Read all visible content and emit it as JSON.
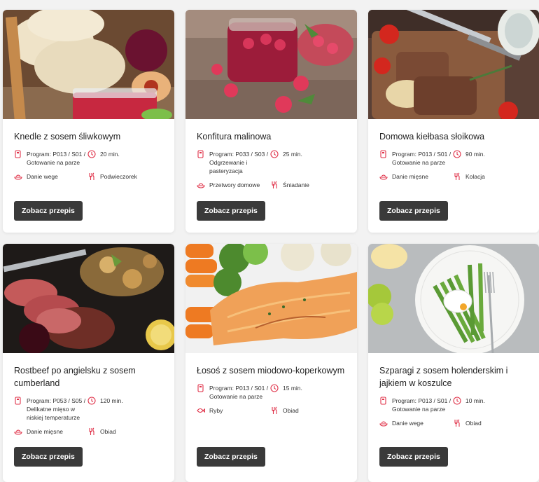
{
  "accent_color": "#e0334a",
  "button_color": "#3a3a3a",
  "cards": [
    {
      "title": "Knedle z sosem śliwkowym",
      "program": "Program: P013 / S01 / Gotowanie na parze",
      "time": "20 min.",
      "category": "Danie wege",
      "meal": "Podwieczorek",
      "button": "Zobacz przepis"
    },
    {
      "title": "Konfitura malinowa",
      "program": "Program: P033 / S03 / Odgrzewanie i pasteryzacja",
      "time": "25 min.",
      "category": "Przetwory domowe",
      "meal": "Śniadanie",
      "button": "Zobacz przepis"
    },
    {
      "title": "Domowa kiełbasa słoikowa",
      "program": "Program: P013 / S01 / Gotowanie na parze",
      "time": "90 min.",
      "category": "Danie mięsne",
      "meal": "Kolacja",
      "button": "Zobacz przepis"
    },
    {
      "title": "Rostbeef po angielsku z sosem cumberland",
      "program": "Program: P053 / S05 / Delikatne mięso w niskiej temperaturze",
      "time": "120 min.",
      "category": "Danie mięsne",
      "meal": "Obiad",
      "button": "Zobacz przepis"
    },
    {
      "title": "Łosoś z sosem miodowo-koperkowym",
      "program": "Program: P013 / S01 / Gotowanie na parze",
      "time": "15 min.",
      "category": "Ryby",
      "meal": "Obiad",
      "button": "Zobacz przepis"
    },
    {
      "title": "Szparagi z sosem holenderskim i jajkiem w koszulce",
      "program": "Program: P013 / S01 / Gotowanie na parze",
      "time": "10 min.",
      "category": "Danie wege",
      "meal": "Obiad",
      "button": "Zobacz przepis"
    }
  ]
}
